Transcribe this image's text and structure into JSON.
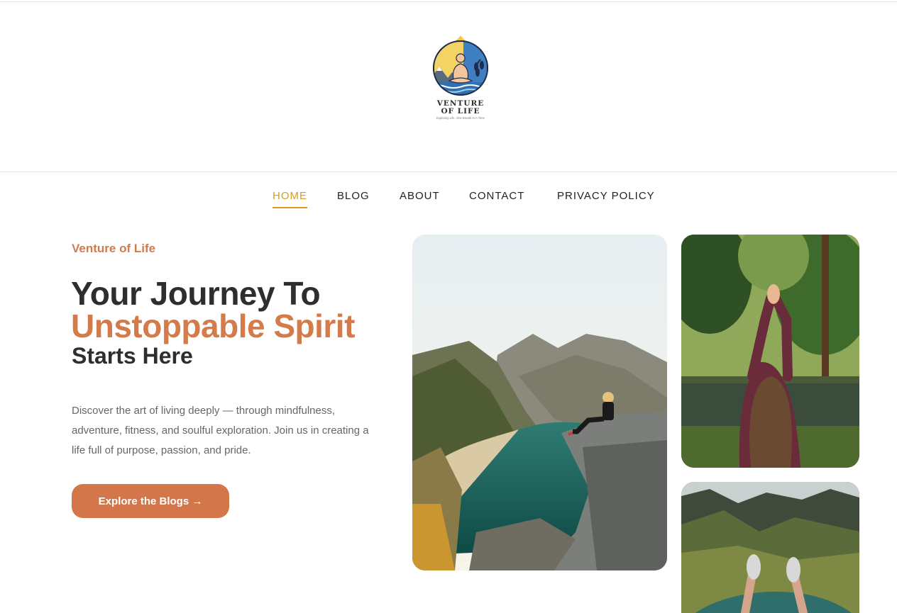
{
  "brand": {
    "name_line1": "VENTURE",
    "name_line2": "OF LIFE",
    "tagline": "Exploring Life, One Breath At A Time"
  },
  "nav": {
    "items": [
      {
        "label": "HOME",
        "active": true
      },
      {
        "label": "BLOG",
        "active": false
      },
      {
        "label": "ABOUT",
        "active": false
      },
      {
        "label": "CONTACT",
        "active": false
      },
      {
        "label": "PRIVACY POLICY",
        "active": false
      }
    ]
  },
  "hero": {
    "eyebrow": "Venture of Life",
    "headline_line1": "Your Journey To",
    "headline_line2": "Unstoppable Spirit",
    "headline_line3": "Starts Here",
    "description": "Discover the art of living deeply — through mindfulness, adventure, fitness, and soulful exploration. Join us in creating a life full of purpose, passion, and pride.",
    "cta_label": "Explore the Blogs →"
  },
  "colors": {
    "accent": "#d37b4a",
    "nav_active": "#d99a1f",
    "heading": "#2e2e2e",
    "body_text": "#666666"
  },
  "images": [
    {
      "name": "mountain-lake-hiker-photo"
    },
    {
      "name": "forest-lake-woman-photo"
    },
    {
      "name": "cliff-edge-feet-photo"
    }
  ]
}
